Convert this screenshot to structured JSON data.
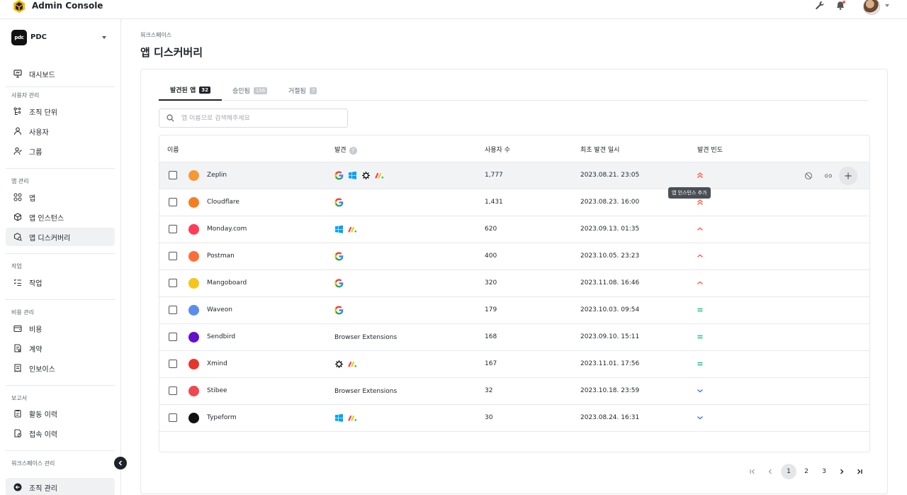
{
  "header": {
    "app_title": "Admin Console",
    "icons": [
      "logo-icon",
      "wrench-icon",
      "bell-icon",
      "avatar"
    ]
  },
  "sidebar": {
    "workspace_logo": "pdc",
    "workspace_name": "PDC",
    "items": [
      {
        "label": "대시보드",
        "icon": "dashboard-icon"
      },
      {
        "label": "조직 단위",
        "icon": "org-unit-icon"
      },
      {
        "label": "사용자",
        "icon": "user-icon"
      },
      {
        "label": "그룹",
        "icon": "group-icon"
      },
      {
        "label": "앱",
        "icon": "apps-icon"
      },
      {
        "label": "앱 인스턴스",
        "icon": "cube-icon"
      },
      {
        "label": "앱 디스커버리",
        "icon": "discovery-icon"
      },
      {
        "label": "작업",
        "icon": "tasks-icon"
      },
      {
        "label": "비용",
        "icon": "wallet-icon"
      },
      {
        "label": "계약",
        "icon": "contract-icon"
      },
      {
        "label": "인보이스",
        "icon": "invoice-icon"
      },
      {
        "label": "활동 이력",
        "icon": "activity-icon"
      },
      {
        "label": "접속 이력",
        "icon": "access-history-icon"
      },
      {
        "label": "조직 관리",
        "icon": "back-circle-icon"
      }
    ],
    "sections": {
      "users": "사용자 관리",
      "apps": "앱 관리",
      "work": "작업",
      "cost": "비용 관리",
      "report": "보고서",
      "workspace": "워크스페이스 관리"
    }
  },
  "main": {
    "breadcrumb": "워크스페이스",
    "title": "앱 디스커버리",
    "tabs": [
      {
        "label": "발견된 앱",
        "count": "32"
      },
      {
        "label": "승인됨",
        "count": "156"
      },
      {
        "label": "거절됨",
        "count": "7"
      }
    ],
    "search_placeholder": "앱 이름으로 검색해주세요",
    "search_value": "",
    "columns": {
      "name": "이름",
      "discovered": "발견",
      "users": "사용자 수",
      "first_seen": "최초 발견 일시",
      "frequency": "발견 빈도"
    },
    "tooltip": "앱 인스턴스 추가",
    "rows": [
      {
        "name": "Zeplin",
        "sources": [
          "google",
          "windows",
          "openai",
          "monday"
        ],
        "users": "1,777",
        "date": "2023.08.21. 23:05",
        "freq": "very-high",
        "icon_color": "#f69833"
      },
      {
        "name": "Cloudflare",
        "sources": [
          "google"
        ],
        "users": "1,431",
        "date": "2023.08.23. 16:00",
        "freq": "very-high",
        "icon_color": "#f38020"
      },
      {
        "name": "Monday.com",
        "sources": [
          "windows",
          "monday"
        ],
        "users": "620",
        "date": "2023.09.13. 01:35",
        "freq": "high",
        "icon_color": "#ff3d57"
      },
      {
        "name": "Postman",
        "sources": [
          "google"
        ],
        "users": "400",
        "date": "2023.10.05. 23:23",
        "freq": "high",
        "icon_color": "#ff6c37"
      },
      {
        "name": "Mangoboard",
        "sources": [
          "google"
        ],
        "users": "320",
        "date": "2023.11.08. 16:46",
        "freq": "high",
        "icon_color": "#f5c518"
      },
      {
        "name": "Waveon",
        "sources": [
          "google"
        ],
        "users": "179",
        "date": "2023.10.03. 09:54",
        "freq": "medium",
        "icon_color": "#5b8def"
      },
      {
        "name": "Sendbird",
        "sources": [],
        "sources_text": "Browser Extensions",
        "users": "168",
        "date": "2023.09.10. 15:11",
        "freq": "medium",
        "icon_color": "#6210cc"
      },
      {
        "name": "Xmind",
        "sources": [
          "openai",
          "monday"
        ],
        "users": "167",
        "date": "2023.11.01. 17:56",
        "freq": "medium",
        "icon_color": "#e8352a"
      },
      {
        "name": "Stibee",
        "sources": [],
        "sources_text": "Browser Extensions",
        "users": "32",
        "date": "2023.10.18. 23:59",
        "freq": "low",
        "icon_color": "#f0474f"
      },
      {
        "name": "Typeform",
        "sources": [
          "windows",
          "monday"
        ],
        "users": "30",
        "date": "2023.08.24. 16:31",
        "freq": "low",
        "icon_color": "#111111"
      }
    ],
    "pagination": {
      "pages": [
        "1",
        "2",
        "3"
      ],
      "current": "1"
    }
  },
  "colors": {
    "accent_dark": "#1f2329",
    "freq_high": "#ff5a36",
    "freq_medium": "#1fc28a",
    "freq_low": "#3b6fe0"
  }
}
